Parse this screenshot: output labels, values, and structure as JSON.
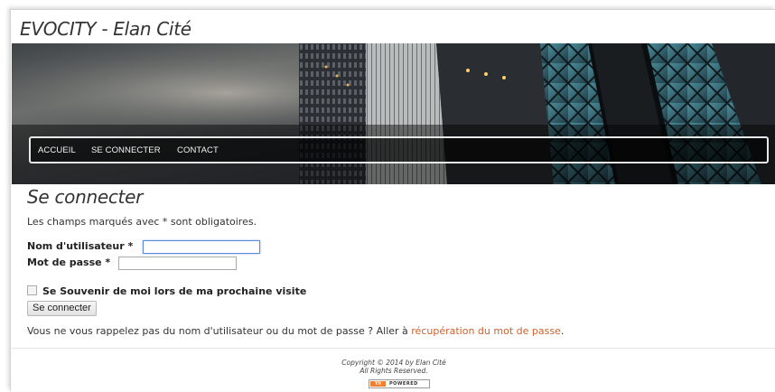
{
  "site": {
    "title": "EVOCITY - Elan Cité"
  },
  "nav": {
    "items": [
      "ACCUEIL",
      "SE CONNECTER",
      "CONTACT"
    ]
  },
  "login": {
    "heading": "Se connecter",
    "required_note": "Les champs marqués avec * sont obligatoires.",
    "username_label": "Nom d'utilisateur *",
    "password_label": "Mot de passe *",
    "remember_label": "Se Souvenir de moi lors de ma prochaine visite",
    "submit_label": "Se connecter",
    "forgot_text": "Vous ne vous rappelez pas du nom d'utilisateur ou du mot de passe ? Aller à ",
    "forgot_link": "récupération du mot de passe",
    "forgot_end": "."
  },
  "footer": {
    "copyright": "Copyright © 2014 by Elan Cité",
    "rights": "All Rights Reserved.",
    "badge_yii": "Yii",
    "badge_powered": "POWERED"
  },
  "colors": {
    "link": "#d0602a",
    "nav_border": "#e8e8e8",
    "focus_border": "#5b8bd8"
  }
}
